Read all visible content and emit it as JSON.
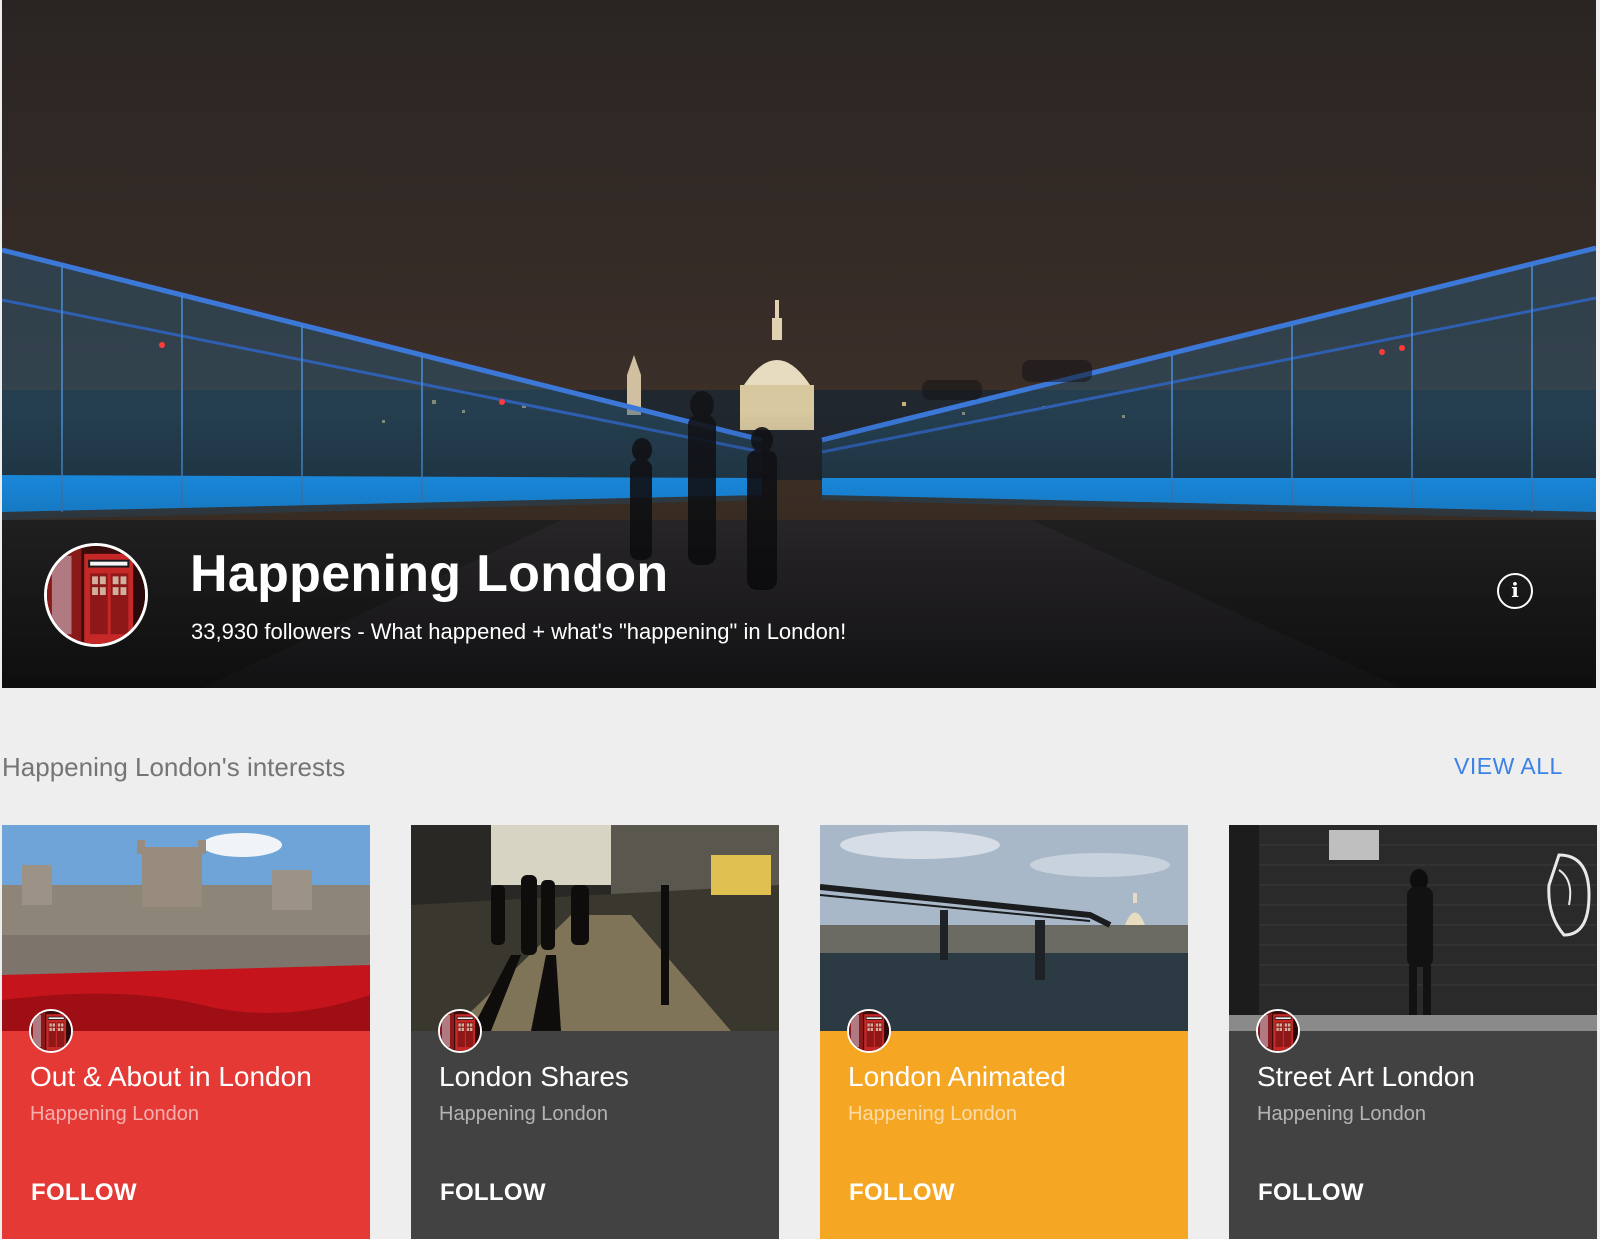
{
  "hero": {
    "title": "Happening London",
    "subtitle": "33,930 followers - What happened + what's \"happening\" in London!",
    "info_icon": "info-icon"
  },
  "section": {
    "title": "Happening London's interests",
    "view_all_label": "VIEW ALL"
  },
  "cards": [
    {
      "title": "Out & About in London",
      "owner": "Happening London",
      "follow_label": "FOLLOW",
      "color": "#e53935"
    },
    {
      "title": "London Shares",
      "owner": "Happening London",
      "follow_label": "FOLLOW",
      "color": "#424242"
    },
    {
      "title": "London Animated",
      "owner": "Happening London",
      "follow_label": "FOLLOW",
      "color": "#f5a623"
    },
    {
      "title": "Street Art London",
      "owner": "Happening London",
      "follow_label": "FOLLOW",
      "color": "#424242"
    }
  ],
  "colors": {
    "background": "#eeeeee",
    "accent": "#3b82e6",
    "section_text": "#757575"
  }
}
